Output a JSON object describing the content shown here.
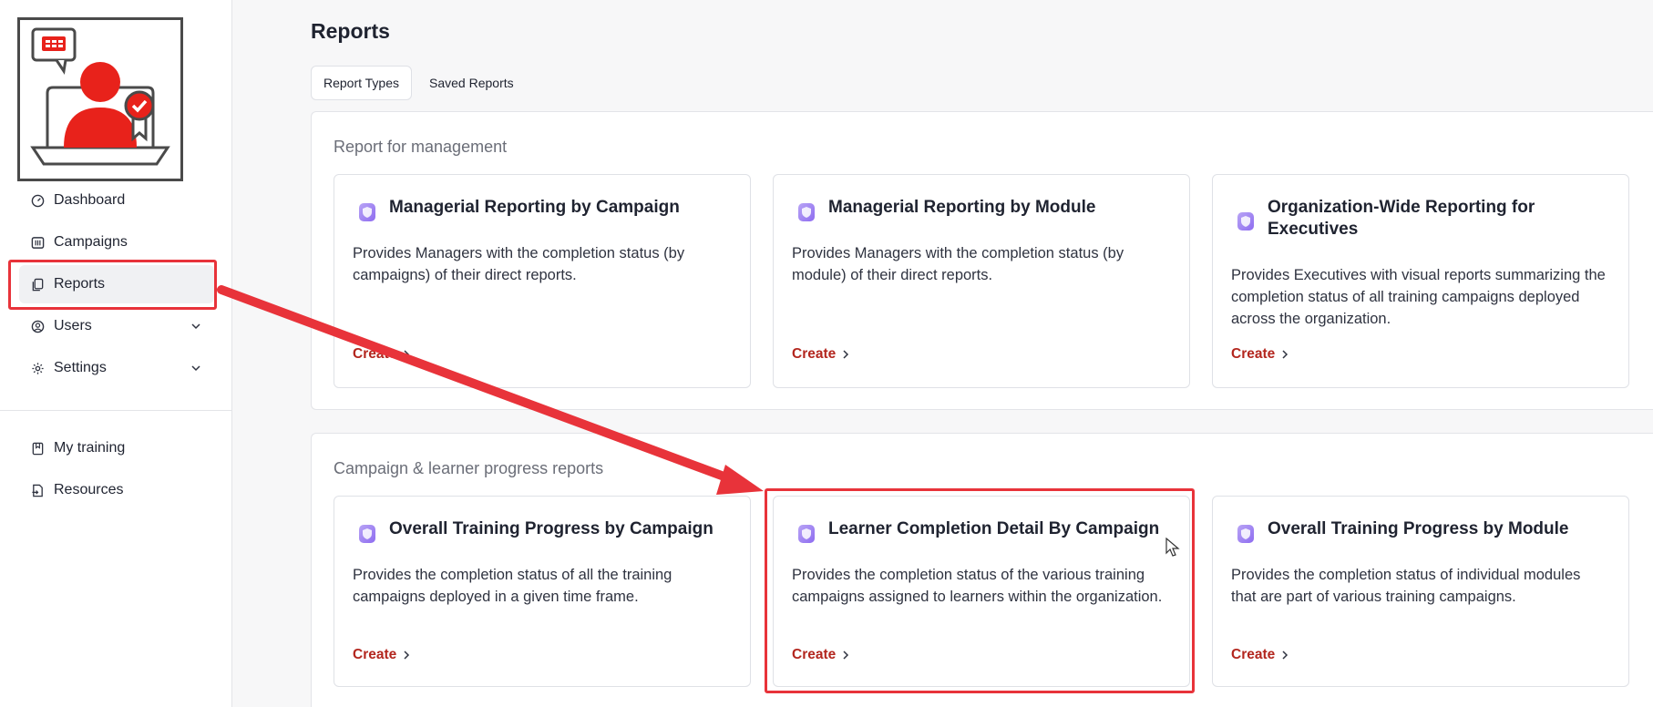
{
  "sidebar": {
    "logo_alt": "Training logo",
    "items": [
      {
        "label": "Dashboard",
        "icon": "gauge-icon"
      },
      {
        "label": "Campaigns",
        "icon": "campaigns-icon"
      },
      {
        "label": "Reports",
        "icon": "reports-icon",
        "active": true
      },
      {
        "label": "Users",
        "icon": "user-circle-icon",
        "expandable": true
      },
      {
        "label": "Settings",
        "icon": "gear-icon",
        "expandable": true
      }
    ],
    "secondary_items": [
      {
        "label": "My training",
        "icon": "bookmark-icon"
      },
      {
        "label": "Resources",
        "icon": "resources-icon"
      }
    ]
  },
  "page": {
    "title": "Reports",
    "tabs": [
      {
        "label": "Report Types",
        "active": true
      },
      {
        "label": "Saved Reports",
        "active": false
      }
    ]
  },
  "sections": [
    {
      "title": "Report for management",
      "cards": [
        {
          "title": "Managerial Reporting by Campaign",
          "description": "Provides Managers with the completion status (by campaigns) of their direct reports.",
          "action": "Create"
        },
        {
          "title": "Managerial Reporting by Module",
          "description": "Provides Managers with the completion status (by module) of their direct reports.",
          "action": "Create"
        },
        {
          "title": "Organization-Wide Reporting for Executives",
          "description": "Provides Executives with visual reports summarizing the completion status of all training campaigns deployed across the organization.",
          "action": "Create"
        }
      ]
    },
    {
      "title": "Campaign & learner progress reports",
      "cards": [
        {
          "title": "Overall Training Progress by Campaign",
          "description": "Provides the completion status of all the training campaigns deployed in a given time frame.",
          "action": "Create"
        },
        {
          "title": "Learner Completion Detail By Campaign",
          "description": "Provides the completion status of the various training campaigns assigned to learners within the organization.",
          "action": "Create"
        },
        {
          "title": "Overall Training Progress by Module",
          "description": "Provides the completion status of individual modules that are part of various training campaigns.",
          "action": "Create"
        }
      ]
    }
  ],
  "colors": {
    "accent": "#b3261e",
    "annotation": "#e8333a",
    "logo_red": "#e8221b"
  }
}
